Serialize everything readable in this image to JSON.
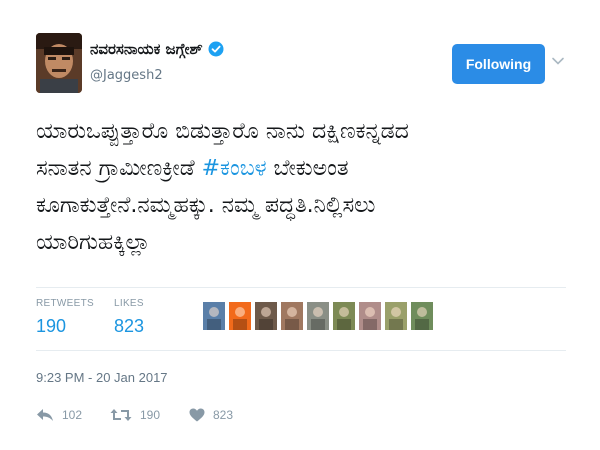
{
  "user": {
    "display_name": "ನವರಸನಾಯಕ ಜಗ್ಗೇಶ್",
    "handle": "@Jaggesh2",
    "verified": true,
    "avatar_icon": "profile-photo"
  },
  "follow_button": {
    "label": "Following",
    "color": "#2b8ce6"
  },
  "tweet": {
    "text_before_hashtag_line1": "ಯಾರುಒಪ್ಪುತ್ತಾರೊ ಬಿಡುತ್ತಾರೊ ನಾನು ದಕ್ಷಿಣಕನ್ನಡದ",
    "text_before_hashtag_line2": "ಸನಾತನ ಗ್ರಾಮೀಣಕ್ರೀಡೆ ",
    "hashtag": "#ಕಂಬಳ",
    "text_after_hashtag": " ಬೇಕುಅಂತ",
    "line3": "ಕೂಗಾಕುತ್ತೇನೆ.ನಮ್ಮಹಕ್ಕು. ನಮ್ಮ ಪದ್ಧತಿ.ನಿಲ್ಲಿಸಲು",
    "line4": "ಯಾರಿಗುಹಕ್ಕಿಲ್ಲಾ",
    "hashtag_color": "#1b95e0"
  },
  "stats": {
    "retweets_label": "RETWEETS",
    "retweets_value": "190",
    "likes_label": "LIKES",
    "likes_value": "823"
  },
  "likers": [
    {
      "color": "#5a7fa8"
    },
    {
      "color": "#f26a1b"
    },
    {
      "color": "#6e5a4a"
    },
    {
      "color": "#a07860"
    },
    {
      "color": "#8a8f86"
    },
    {
      "color": "#7d8a55"
    },
    {
      "color": "#b08d8a"
    },
    {
      "color": "#9aa06a"
    },
    {
      "color": "#6f8d5c"
    }
  ],
  "timestamp": "9:23 PM - 20 Jan 2017",
  "actions": {
    "reply_count": "102",
    "retweet_count": "190",
    "like_count": "823",
    "reply_icon": "reply-icon",
    "retweet_icon": "retweet-icon",
    "like_icon": "heart-icon"
  }
}
